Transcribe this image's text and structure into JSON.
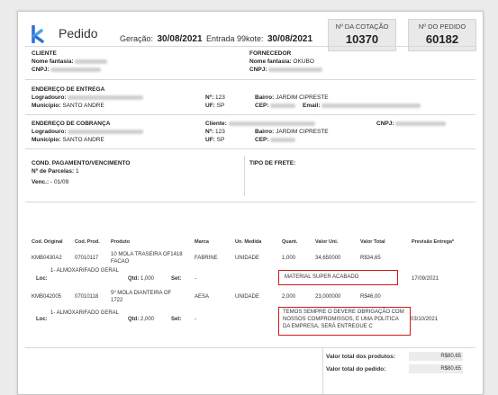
{
  "header": {
    "title": "Pedido",
    "geracao_label": "Geração:",
    "geracao_value": "30/08/2021",
    "entrada_label": "Entrada 99kote:",
    "entrada_value": "30/08/2021",
    "cotacao_label": "Nº DA COTAÇÃO",
    "cotacao_value": "10370",
    "pedido_label": "Nº DO PEDIDO",
    "pedido_value": "60182"
  },
  "cliente": {
    "title": "CLIENTE",
    "nome_label": "Nome fantasia:",
    "cnpj_label": "CNPJ:"
  },
  "fornecedor": {
    "title": "FORNECEDOR",
    "nome_label": "Nome fantasia:",
    "nome_value": "OKUBO",
    "cnpj_label": "CNPJ:"
  },
  "entrega": {
    "title": "ENDEREÇO DE ENTREGA",
    "logradouro_label": "Logradouro:",
    "municipio_label": "Município:",
    "municipio_value": "SANTO ANDRE",
    "num_label": "Nº:",
    "num_value": "123",
    "uf_label": "UF:",
    "uf_value": "SP",
    "bairro_label": "Bairro:",
    "bairro_value": "JARDIM CIPRESTE",
    "cep_label": "CEP:",
    "email_label": "Email:"
  },
  "cobranca": {
    "title": "ENDEREÇO DE COBRANÇA",
    "logradouro_label": "Logradouro:",
    "municipio_label": "Município:",
    "municipio_value": "SANTO ANDRE",
    "cliente_label": "Cliente:",
    "num_label": "Nº:",
    "num_value": "123",
    "uf_label": "UF:",
    "uf_value": "SP",
    "bairro_label": "Bairro:",
    "bairro_value": "JARDIM CIPRESTE",
    "cep_label": "CEP:",
    "cnpj_label": "CNPJ:"
  },
  "pagamento": {
    "title": "COND. PAGAMENTO/VENCIMENTO",
    "parcelas_label": "Nº de Parcelas:",
    "parcelas_value": "1",
    "venc_label": "Venc.:",
    "venc_value": "- 01/09"
  },
  "frete": {
    "title": "TIPO DE FRETE:"
  },
  "table": {
    "headers": {
      "cod_original": "Cod. Original",
      "cod_prod": "Cod. Prod.",
      "produto": "Produto",
      "marca": "Marca",
      "un_medida": "Un. Medida",
      "quant": "Quant.",
      "valor_uni": "Valor Uni.",
      "valor_total": "Valor Total",
      "previsao": "Previsão Entrega*"
    },
    "rows": [
      {
        "cod_original": "KMB0430A2",
        "cod_prod": "07010117",
        "produto_l1": "10 MOLA TRASEIRA OF1418",
        "produto_l2": "FACAO",
        "marca": "FABRINE",
        "un_medida": "UNIDADE",
        "quant": "1,000",
        "valor_uni": "34,650000",
        "valor_total": "R$34,65",
        "loc_label": "Loc:",
        "loc_l1": "1- ALMOXARIFADO GERAL",
        "qtd_label": "Qtd:",
        "qtd_value": "1,000",
        "set_label": "Set:",
        "set_value": "-",
        "obs": "MATERIAL SUPER ACABADO",
        "previsao": "17/09/2021"
      },
      {
        "cod_original": "KMB042005",
        "cod_prod": "07010118",
        "produto_l1": "5º MOLA DIANTEIRA OF",
        "produto_l2": "1722",
        "marca": "AESA",
        "un_medida": "UNIDADE",
        "quant": "2,000",
        "valor_uni": "23,000000",
        "valor_total": "R$46,00",
        "loc_label": "Loc:",
        "loc_l1": "1- ALMOXARIFADO GERAL",
        "qtd_label": "Qtd:",
        "qtd_value": "2,000",
        "set_label": "Set:",
        "set_value": "-",
        "obs_l1": "TEMOS SEMPRE O DEVERE OBRIGAÇÃO COM",
        "obs_l2": "NOSSOS COMPROMISSOS, E UMA POLITICA",
        "obs_l3": "DA EMPRESA, SERÁ ENTREGUE C",
        "previsao": "03/10/2021"
      }
    ]
  },
  "totals": {
    "produtos_label": "Valor total dos produtos:",
    "produtos_value": "R$80,65",
    "pedido_label": "Valor total do pedido:",
    "pedido_value": "R$80,65"
  },
  "colors": {
    "brand": "#2f6fd6",
    "highlight": "#d01a1a"
  }
}
